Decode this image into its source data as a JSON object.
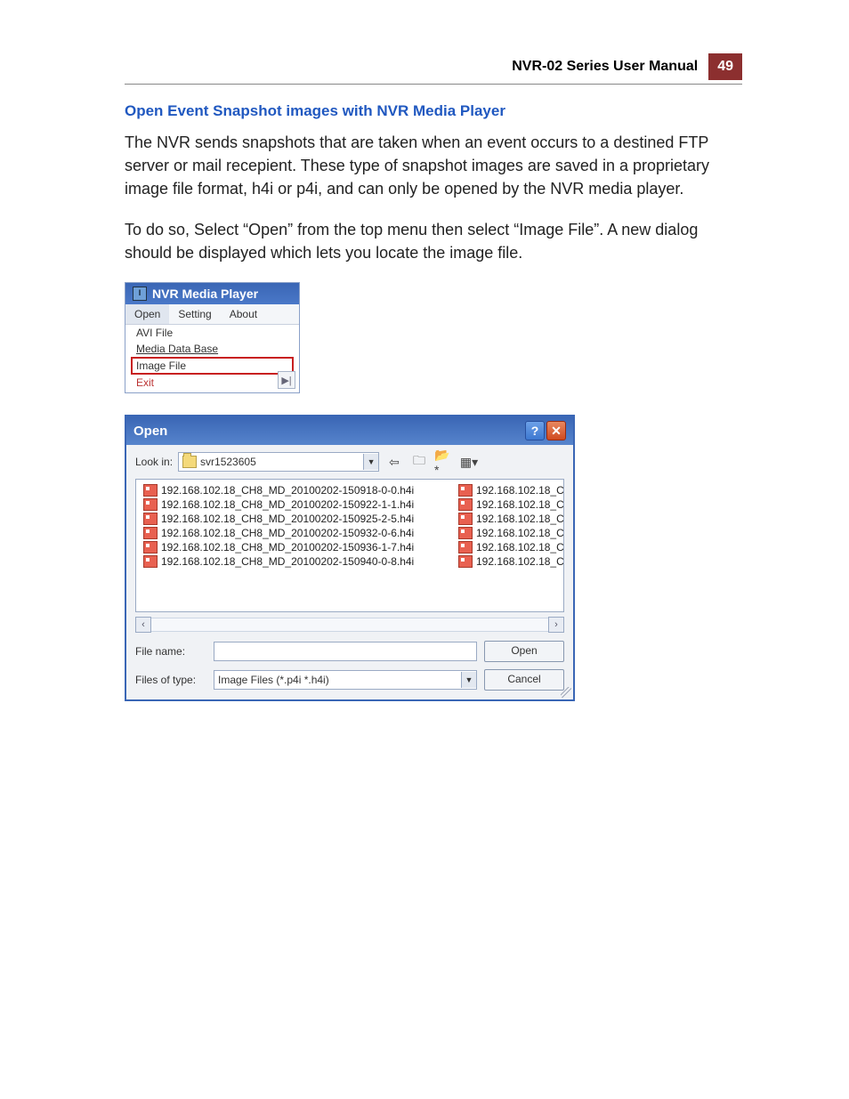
{
  "header": {
    "title": "NVR-02 Series User Manual",
    "page_number": "49"
  },
  "section_heading": "Open Event Snapshot images with NVR Media Player",
  "paragraph1": "The NVR sends snapshots that are taken when an event occurs to a destined FTP server or mail recepient. These type of snapshot images are saved in a proprietary image file format, h4i or p4i, and can only be opened by the NVR media player.",
  "paragraph2": "To do so, Select “Open” from the top menu then select “Image File”. A new dialog should be displayed which lets you locate the image file.",
  "nvr_window": {
    "title": "NVR Media Player",
    "menu": {
      "open": "Open",
      "setting": "Setting",
      "about": "About"
    },
    "dropdown": {
      "avi": "AVI File",
      "mdb": "Media Data Base",
      "image": "Image File",
      "exit": "Exit"
    }
  },
  "open_dialog": {
    "title": "Open",
    "look_in_label": "Look in:",
    "look_in_value": "svr1523605",
    "files_left": [
      "192.168.102.18_CH8_MD_20100202-150918-0-0.h4i",
      "192.168.102.18_CH8_MD_20100202-150922-1-1.h4i",
      "192.168.102.18_CH8_MD_20100202-150925-2-5.h4i",
      "192.168.102.18_CH8_MD_20100202-150932-0-6.h4i",
      "192.168.102.18_CH8_MD_20100202-150936-1-7.h4i",
      "192.168.102.18_CH8_MD_20100202-150940-0-8.h4i"
    ],
    "files_right": [
      "192.168.102.18_C",
      "192.168.102.18_C",
      "192.168.102.18_C",
      "192.168.102.18_C",
      "192.168.102.18_C",
      "192.168.102.18_C"
    ],
    "file_name_label": "File name:",
    "file_name_value": "",
    "file_type_label": "Files of type:",
    "file_type_value": "Image Files (*.p4i *.h4i)",
    "open_btn": "Open",
    "cancel_btn": "Cancel"
  }
}
